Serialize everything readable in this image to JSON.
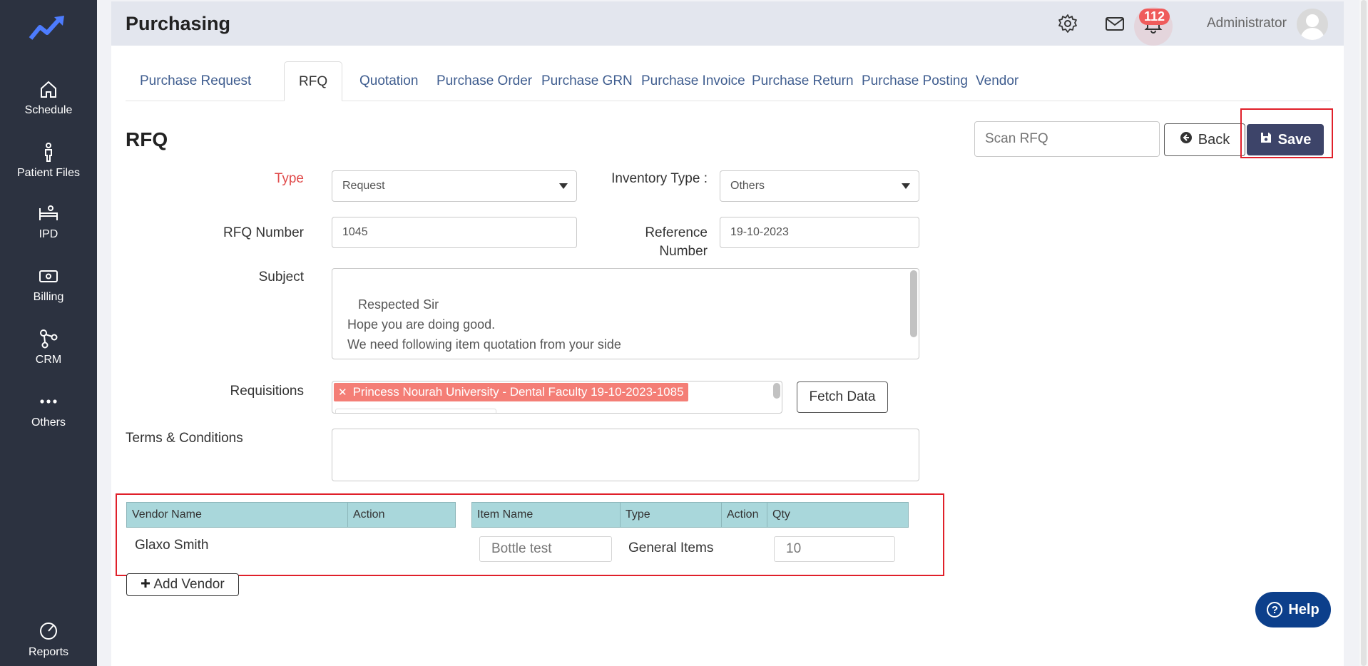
{
  "sidebar": {
    "logo": "app-logo",
    "items": [
      {
        "label": "Schedule",
        "icon": "home-icon"
      },
      {
        "label": "Patient Files",
        "icon": "person-icon"
      },
      {
        "label": "IPD",
        "icon": "bed-icon"
      },
      {
        "label": "Billing",
        "icon": "money-icon"
      },
      {
        "label": "CRM",
        "icon": "network-icon"
      },
      {
        "label": "Others",
        "icon": "dots-icon"
      },
      {
        "label": "Reports",
        "icon": "pie-chart-icon"
      }
    ]
  },
  "header": {
    "title": "Purchasing",
    "notification_count": "112",
    "user_name": "Administrator"
  },
  "tabs": [
    {
      "label": "Purchase Request"
    },
    {
      "label": "RFQ"
    },
    {
      "label": "Quotation"
    },
    {
      "label": "Purchase Order"
    },
    {
      "label": "Purchase GRN"
    },
    {
      "label": "Purchase Invoice"
    },
    {
      "label": "Purchase Return"
    },
    {
      "label": "Purchase Posting"
    },
    {
      "label": "Vendor"
    }
  ],
  "form": {
    "title": "RFQ",
    "scan_placeholder": "Scan RFQ",
    "back_label": "Back",
    "save_label": "Save",
    "type_label": "Type",
    "type_value": "Request",
    "inventory_type_label": "Inventory Type :",
    "inventory_type_value": "Others",
    "rfq_number_label": "RFQ Number",
    "rfq_number_value": "1045",
    "reference_number_label_1": "Reference",
    "reference_number_label_2": "Number",
    "reference_number_value": "19-10-2023",
    "subject_label": "Subject",
    "subject_value": "Respected Sir\n Hope you are doing good.\n We need following item quotation from your side\n Looking forward to your response.\n Thanks",
    "requisitions_label": "Requisitions",
    "requisition_tag": "Princess Nourah University - Dental Faculty 19-10-2023-1085",
    "fetch_label": "Fetch Data",
    "terms_label": "Terms & Conditions",
    "terms_value": ""
  },
  "vendor_table": {
    "headers": [
      "Vendor Name",
      "Action"
    ],
    "rows": [
      {
        "vendor": "Glaxo Smith"
      }
    ]
  },
  "item_table": {
    "headers": [
      "Item Name",
      "Type",
      "Action",
      "Qty"
    ],
    "rows": [
      {
        "item": "Bottle test",
        "type": "General Items",
        "qty": "10"
      }
    ]
  },
  "add_vendor_label": "Add Vendor",
  "help_label": "Help",
  "colors": {
    "sidebar": "#2c3240",
    "primary": "#3d4469",
    "tab_link": "#3f5d8f",
    "grid_header": "#a9d7db",
    "tag": "#f47e76",
    "highlight": "#e0202a",
    "help": "#0c3f8b"
  }
}
